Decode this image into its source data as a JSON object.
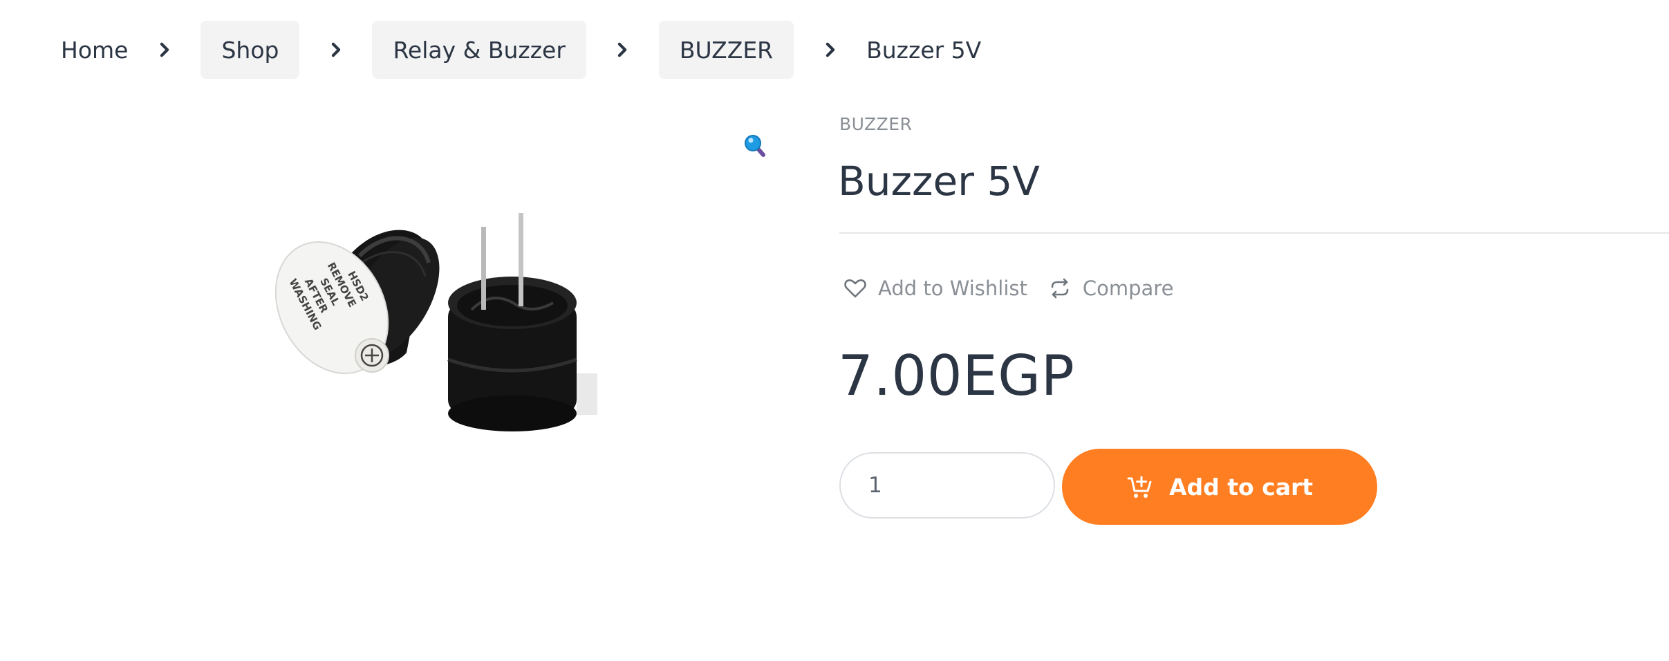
{
  "breadcrumb": {
    "items": [
      {
        "label": "Home"
      },
      {
        "label": "Shop"
      },
      {
        "label": "Relay & Buzzer"
      },
      {
        "label": "BUZZER"
      }
    ],
    "current": "Buzzer 5V"
  },
  "product": {
    "category": "BUZZER",
    "title": "Buzzer 5V",
    "image_alt": "Buzzer 5V",
    "image_printed_text": "REMOVE SEAL AFTER WASHING HSD2",
    "price": "7.00EGP",
    "quantity": "1"
  },
  "actions": {
    "wishlist_label": "Add to Wishlist",
    "compare_label": "Compare"
  },
  "cart": {
    "add_label": "Add to cart"
  },
  "colors": {
    "accent": "#ff7e22",
    "text": "#2b3543",
    "muted": "#8a8f96",
    "crumb_bg": "#f3f3f4"
  },
  "icons": [
    "chevron-right-icon",
    "zoom-icon",
    "heart-icon",
    "compare-icon",
    "cart-add-icon"
  ]
}
